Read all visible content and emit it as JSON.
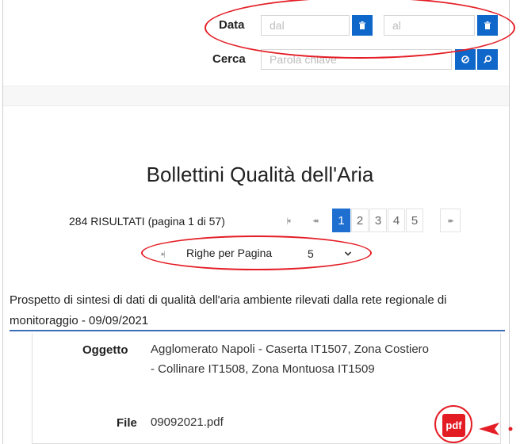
{
  "filters": {
    "date_label": "Data",
    "from_placeholder": "dal",
    "to_placeholder": "al",
    "search_label": "Cerca",
    "search_placeholder": "Parola chiave"
  },
  "page_title": "Bollettini Qualità dell'Aria",
  "pagination": {
    "results_text": "284 RISULTATI (pagina 1 di 57)",
    "first_icon": "first-page-icon",
    "prev_icon": "previous-page-icon",
    "pages": [
      "1",
      "2",
      "3",
      "4",
      "5"
    ],
    "active_page": "1",
    "next_icon": "next-page-icon"
  },
  "rows_per_page": {
    "label": "Righe per Pagina",
    "value": "5"
  },
  "item": {
    "title": "Prospetto di sintesi di dati di qualità dell'aria ambiente rilevati dalla rete regionale di monitoraggio - 09/09/2021",
    "oggetto_label": "Oggetto",
    "oggetto_value": "Agglomerato Napoli - Caserta IT1507, Zona Costiero - Collinare IT1508, Zona Montuosa IT1509",
    "file_label": "File",
    "file_value": "09092021.pdf",
    "pdf_badge": "pdf"
  },
  "colors": {
    "accent_blue": "#0f67c9",
    "annotation_red": "#e41e26",
    "pdf_red": "#e31b23"
  }
}
